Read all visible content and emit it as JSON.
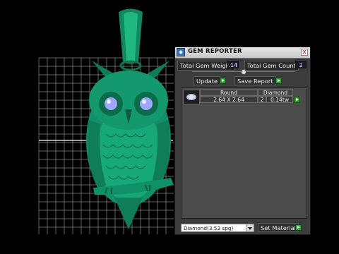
{
  "viewport": {
    "icons": {
      "owl_pendant": "owl-pendant-model",
      "grid": "grid-icon"
    },
    "colors": {
      "model": "#17a878",
      "grid": "#e6e6e6",
      "eye_gem": "#9ea6ff"
    }
  },
  "gem_reporter": {
    "title": "GEM REPORTER",
    "close_label": "x",
    "total_weight_label": "Total Gem Weight",
    "total_weight_value": ".14",
    "total_count_label": "Total Gem Count",
    "total_count_value": "2",
    "update_label": "Update",
    "save_report_label": "Save Report",
    "gem_row": {
      "shape": "Round",
      "size": "2.64 X 2.64",
      "material": "Diamond",
      "count": "2",
      "carat": "0.14tw"
    },
    "material_select": {
      "name": "Diamond",
      "sg": "(3.52 spg)"
    },
    "set_material_label": "Set Material",
    "colors": {
      "accent_green": "#2f9f2f",
      "panel_bg": "#3c3c3c"
    }
  }
}
